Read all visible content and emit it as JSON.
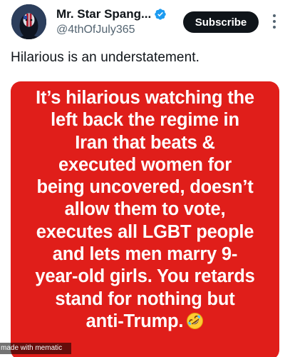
{
  "post": {
    "author": {
      "display_name": "Mr. Star Spang...",
      "handle": "@4thOfJuly365",
      "verified_icon": "verified-badge-icon",
      "avatar_icon": "avatar"
    },
    "subscribe_label": "Subscribe",
    "more_icon": "more-options-icon",
    "text": "Hilarious is an understatement.",
    "media": {
      "background_color": "#e01e1a",
      "lines": [
        "It’s hilarious watching the",
        "left back the regime in",
        "Iran that beats &",
        "executed women for",
        "being uncovered, doesn’t",
        "allow them to vote,",
        "executes all LGBT people",
        "and lets men marry 9-",
        "year-old girls. You retards",
        "stand for nothing but",
        "anti-Trump."
      ],
      "emoji_icon": "rolling-on-floor-laughing-emoji-icon",
      "watermark": "made with mematic"
    }
  },
  "colors": {
    "accent": "#1d9bf0",
    "text_primary": "#0f1419",
    "text_secondary": "#536471",
    "meme_red": "#e01e1a"
  }
}
